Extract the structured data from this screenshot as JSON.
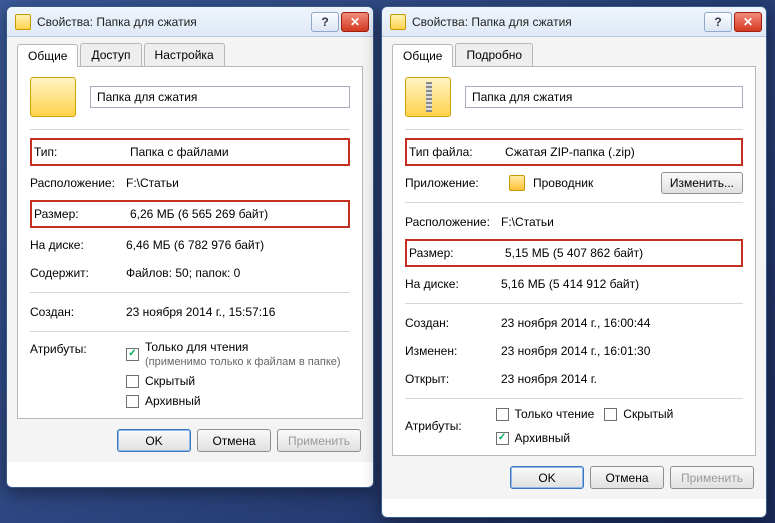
{
  "left": {
    "title": "Свойства: Папка для сжатия",
    "name": "Папка для сжатия",
    "tabs": {
      "general": "Общие",
      "access": "Доступ",
      "settings": "Настройка"
    },
    "labels": {
      "type": "Тип:",
      "location": "Расположение:",
      "size": "Размер:",
      "ondisk": "На диске:",
      "contains": "Содержит:",
      "created": "Создан:",
      "attrs": "Атрибуты:"
    },
    "values": {
      "type": "Папка с файлами",
      "location": "F:\\Статьи",
      "size": "6,26 МБ (6 565 269 байт)",
      "ondisk": "6,46 МБ (6 782 976 байт)",
      "contains": "Файлов: 50; папок: 0",
      "created": "23 ноября 2014 г., 15:57:16"
    },
    "attrs": {
      "readonly": "Только для чтения",
      "readonly_note": "(применимо только к файлам в папке)",
      "hidden": "Скрытый",
      "archive": "Архивный",
      "readonly_checked": true,
      "hidden_checked": false,
      "archive_checked": false
    },
    "buttons": {
      "ok": "OK",
      "cancel": "Отмена",
      "apply": "Применить"
    }
  },
  "right": {
    "title": "Свойства: Папка для сжатия",
    "name": "Папка для сжатия",
    "tabs": {
      "general": "Общие",
      "details": "Подробно"
    },
    "labels": {
      "filetype": "Тип файла:",
      "app": "Приложение:",
      "location": "Расположение:",
      "size": "Размер:",
      "ondisk": "На диске:",
      "created": "Создан:",
      "modified": "Изменен:",
      "opened": "Открыт:",
      "attrs": "Атрибуты:"
    },
    "values": {
      "filetype": "Сжатая ZIP-папка (.zip)",
      "app": "Проводник",
      "location": "F:\\Статьи",
      "size": "5,15 МБ (5 407 862 байт)",
      "ondisk": "5,16 МБ (5 414 912 байт)",
      "created": "23 ноября 2014 г., 16:00:44",
      "modified": "23 ноября 2014 г., 16:01:30",
      "opened": "23 ноября 2014 г."
    },
    "attrs": {
      "readonly": "Только чтение",
      "hidden": "Скрытый",
      "archive": "Архивный",
      "readonly_checked": false,
      "hidden_checked": false,
      "archive_checked": true
    },
    "buttons": {
      "change": "Изменить...",
      "ok": "OK",
      "cancel": "Отмена",
      "apply": "Применить"
    }
  }
}
